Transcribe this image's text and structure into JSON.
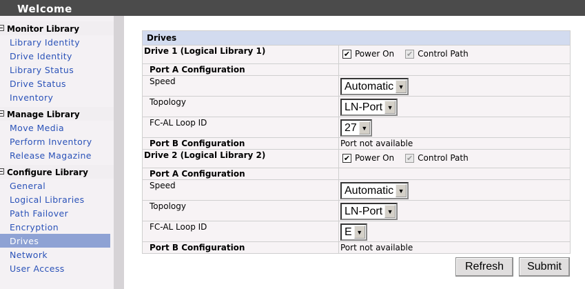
{
  "header": {
    "title": "Welcome"
  },
  "sidebar": {
    "sections": [
      {
        "label": "Monitor Library",
        "items": [
          "Library Identity",
          "Drive Identity",
          "Library Status",
          "Drive Status",
          "Inventory"
        ]
      },
      {
        "label": "Manage Library",
        "items": [
          "Move Media",
          "Perform Inventory",
          "Release Magazine"
        ]
      },
      {
        "label": "Configure Library",
        "items": [
          "General",
          "Logical Libraries",
          "Path Failover",
          "Encryption",
          "Drives",
          "Network",
          "User Access"
        ]
      }
    ],
    "selected": "Drives",
    "section_icon": "minus-box-icon"
  },
  "table": {
    "title": "Drives",
    "drives": [
      {
        "name": "Drive 1 (Logical Library 1)",
        "power_on": "Power On",
        "power_on_checked": true,
        "control_path": "Control Path",
        "control_path_checked": true,
        "port_a": "Port A Configuration",
        "speed_label": "Speed",
        "speed": "Automatic",
        "topology_label": "Topology",
        "topology": "LN-Port",
        "loop_label": "FC-AL Loop ID",
        "loop_id": "27",
        "port_b": "Port B Configuration",
        "port_b_status": "Port not available"
      },
      {
        "name": "Drive 2 (Logical Library 2)",
        "power_on": "Power On",
        "power_on_checked": true,
        "control_path": "Control Path",
        "control_path_checked": true,
        "port_a": "Port A Configuration",
        "speed_label": "Speed",
        "speed": "Automatic",
        "topology_label": "Topology",
        "topology": "LN-Port",
        "loop_label": "FC-AL Loop ID",
        "loop_id": "E",
        "port_b": "Port B Configuration",
        "port_b_status": "Port not available"
      }
    ]
  },
  "buttons": {
    "refresh": "Refresh",
    "submit": "Submit"
  }
}
